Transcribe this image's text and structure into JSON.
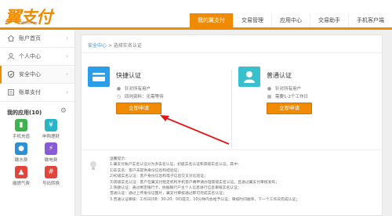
{
  "header": {
    "logo_text": "翼支付",
    "logo_sub": "BestPay",
    "tabs": [
      {
        "label": "我的翼支付",
        "active": true
      },
      {
        "label": "交易管理",
        "active": false
      },
      {
        "label": "应用中心",
        "active": false
      },
      {
        "label": "交易助手",
        "active": false
      },
      {
        "label": "手机客户端",
        "active": false
      }
    ]
  },
  "sidebar": {
    "items": [
      {
        "label": "账户首页",
        "icon": "home-icon"
      },
      {
        "label": "个人中心",
        "icon": "user-icon"
      },
      {
        "label": "安全中心",
        "icon": "shield-icon",
        "active": true
      },
      {
        "label": "账单支付",
        "icon": "bill-icon"
      }
    ],
    "apps_title": "我的应用(10)",
    "apps": [
      {
        "label": "手机充值",
        "icon": "phone-recharge-icon",
        "color": "#3fb34f"
      },
      {
        "label": "申购理财",
        "icon": "finance-icon",
        "color": "#26b4c6"
      },
      {
        "label": "缴水费",
        "icon": "water-icon",
        "color": "#2d8fd6"
      },
      {
        "label": "缴电费",
        "icon": "electricity-icon",
        "color": "#8a5bd6"
      },
      {
        "label": "缴燃气费",
        "icon": "gas-icon",
        "color": "#e0463c"
      },
      {
        "label": "号码转换",
        "icon": "number-icon",
        "color": "#e0463c"
      }
    ]
  },
  "main": {
    "breadcrumb_home": "安全中心",
    "breadcrumb_sep": ">",
    "breadcrumb_current": "选择实名认证",
    "cards": [
      {
        "title": "快捷认证",
        "row1": "针对所有用户",
        "row2": "四则资料：无需等待",
        "button": "立即申请"
      },
      {
        "title": "普通认证",
        "row1": "针对所有用户",
        "row2": "需要1-2个工作日",
        "button": "立即申请"
      }
    ],
    "tips": [
      "温馨提示:",
      "1.翼支付账户实名认证分为多实名认证、初级实名认证和高级实名认证，其中：",
      "  1)非实名：客户未提供身份信息和结验证；",
      "  2)初级实名认证：客户身份信息和电子信息交叉对比验证；",
      "  3)高级实名认证：客户在翼支付指定机构手机客户端申请办理高级实名认证，且通过翼支付审核发布；",
      "2.快捷认证：通过绑定银行卡，依据银行户主个人信息进行信息审核实名认证；",
      "  普通认证：通过上传身份证图片，翼支付审核通过即可完成实名认证；",
      "3.普通认证审核：工作日(08：30-20：00)提交，10分钟内会给予认证；审核时间顺序，下一个工作日完成认证；"
    ]
  },
  "colors": {
    "accent": "#f08a00",
    "card_icon_left": "#2c9ee8",
    "card_icon_right": "#3ac0cc"
  }
}
